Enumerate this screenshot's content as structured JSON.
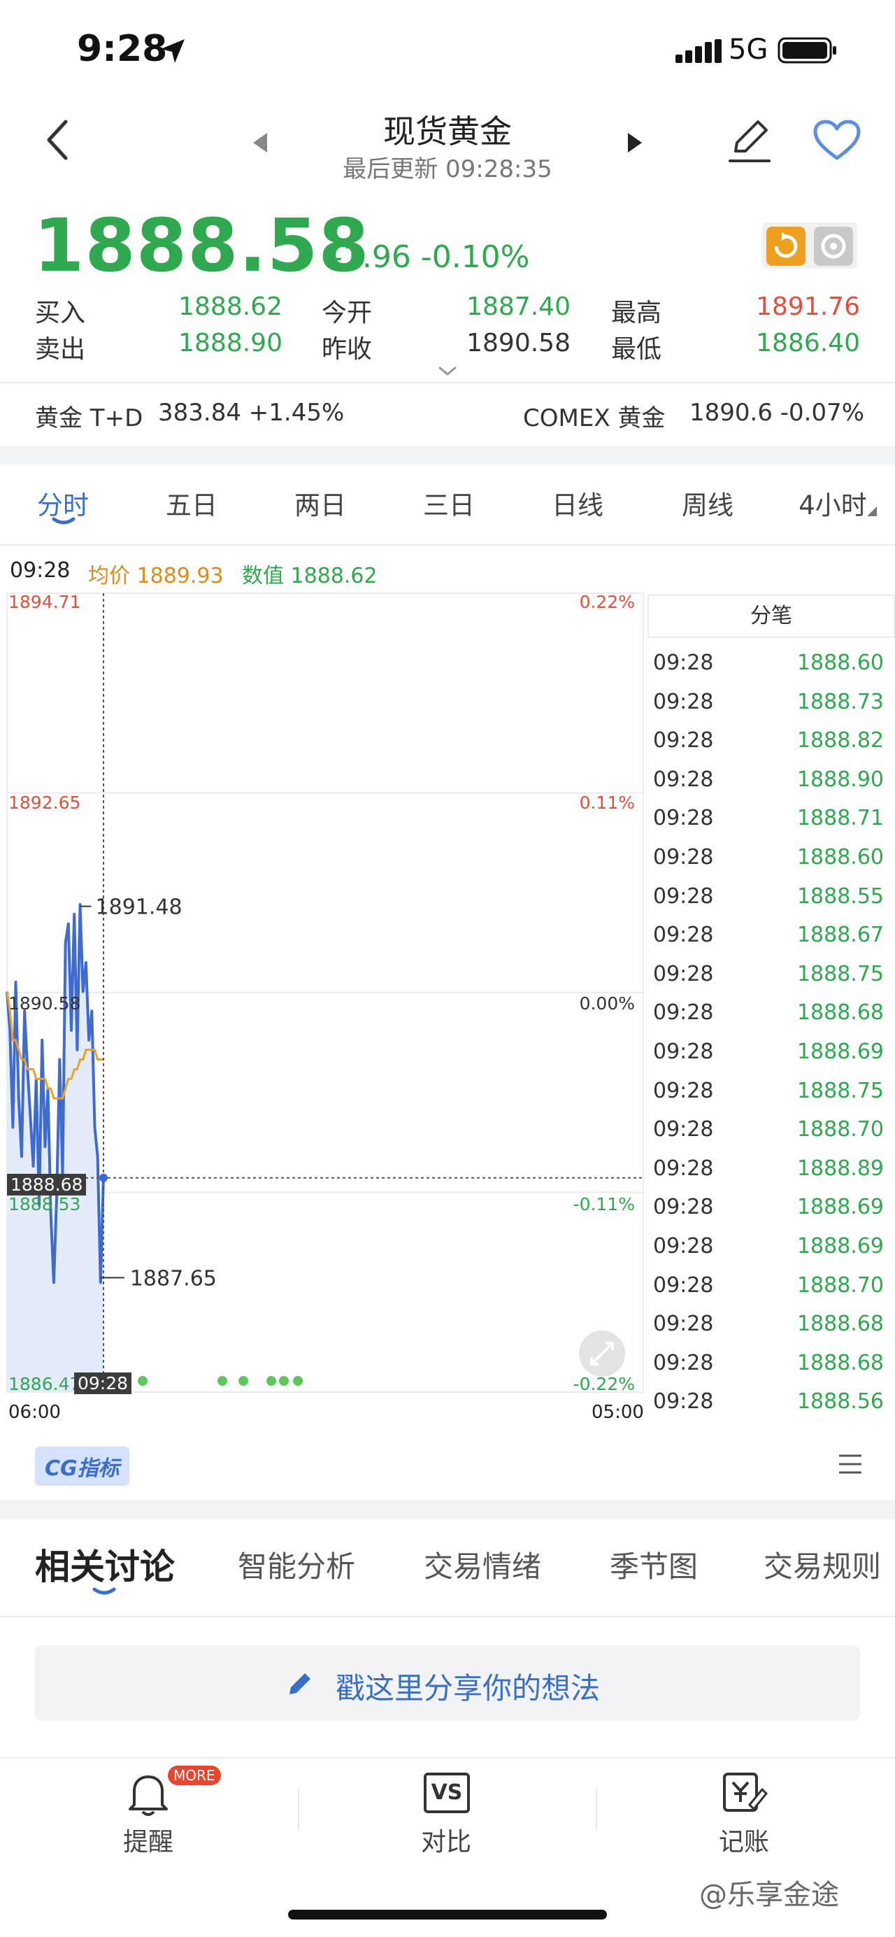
{
  "status": {
    "time": "9:28",
    "network": "5G"
  },
  "header": {
    "title": "现货黄金",
    "subtitle": "最后更新 09:28:35"
  },
  "quote": {
    "price": "1888.58",
    "change": "-1.96 -0.10%",
    "rows": [
      {
        "l1": "买入",
        "v1": "1888.62",
        "l2": "今开",
        "v2": "1887.40",
        "l3": "最高",
        "v3": "1891.76"
      },
      {
        "l1": "卖出",
        "v1": "1888.90",
        "l2": "昨收",
        "v2": "1890.58",
        "l3": "最低",
        "v3": "1886.40"
      }
    ]
  },
  "related": [
    {
      "name": "黄金 T+D",
      "value": "383.84 +1.45%"
    },
    {
      "name": "COMEX 黄金",
      "value": "1890.6 -0.07%"
    }
  ],
  "tabs": [
    "分时",
    "五日",
    "两日",
    "三日",
    "日线",
    "周线",
    "4小时"
  ],
  "info_line": {
    "time": "09:28",
    "avg": "均价 1889.93",
    "val": "数值 1888.62"
  },
  "colors": {
    "up": "#e0503b",
    "down": "#2fa84f",
    "accent": "#3a6fc8",
    "avg": "#f0a020"
  },
  "chart_data": {
    "type": "line",
    "y_left_ticks": [
      "1894.71",
      "1892.65",
      "1890.58",
      "1888.53",
      "1886.47"
    ],
    "y_right_ticks": [
      "0.22%",
      "0.11%",
      "0.00%",
      "-0.11%",
      "-0.22%"
    ],
    "x_start": "06:00",
    "x_end": "05:00",
    "ylim": [
      1886.47,
      1894.71
    ],
    "high_label": "1891.48",
    "low_label": "1887.65",
    "cursor_price": "1888.68",
    "cursor_time": "09:28",
    "series": [
      {
        "values": [
          1890.6,
          1890.2,
          1889.2,
          1890.7,
          1889.5,
          1888.9,
          1890.4,
          1889.8,
          1889.3,
          1888.8,
          1889.7,
          1888.4,
          1890.1,
          1889.0,
          1889.6,
          1888.3,
          1887.6,
          1888.5,
          1889.9,
          1888.7,
          1891.1,
          1891.3,
          1890.2,
          1891.4,
          1890.0,
          1891.5,
          1890.6,
          1890.9,
          1890.1,
          1890.4,
          1889.2,
          1888.9,
          1887.6,
          1888.7
        ]
      },
      {
        "values": [
          1890.6,
          1890.4,
          1890.1,
          1890.1,
          1890.0,
          1889.9,
          1889.9,
          1889.8,
          1889.8,
          1889.8,
          1889.7,
          1889.7,
          1889.7,
          1889.7,
          1889.6,
          1889.6,
          1889.5,
          1889.5,
          1889.5,
          1889.5,
          1889.6,
          1889.7,
          1889.7,
          1889.8,
          1889.8,
          1889.9,
          1889.9,
          1890.0,
          1890.0,
          1890.0,
          1890.0,
          1889.9,
          1889.9,
          1889.9
        ]
      }
    ]
  },
  "ticks_header": "分笔",
  "ticks": [
    [
      "09:28",
      "1888.60"
    ],
    [
      "09:28",
      "1888.73"
    ],
    [
      "09:28",
      "1888.82"
    ],
    [
      "09:28",
      "1888.90"
    ],
    [
      "09:28",
      "1888.71"
    ],
    [
      "09:28",
      "1888.60"
    ],
    [
      "09:28",
      "1888.55"
    ],
    [
      "09:28",
      "1888.67"
    ],
    [
      "09:28",
      "1888.75"
    ],
    [
      "09:28",
      "1888.68"
    ],
    [
      "09:28",
      "1888.69"
    ],
    [
      "09:28",
      "1888.75"
    ],
    [
      "09:28",
      "1888.70"
    ],
    [
      "09:28",
      "1888.89"
    ],
    [
      "09:28",
      "1888.69"
    ],
    [
      "09:28",
      "1888.69"
    ],
    [
      "09:28",
      "1888.70"
    ],
    [
      "09:28",
      "1888.68"
    ],
    [
      "09:28",
      "1888.68"
    ],
    [
      "09:28",
      "1888.56"
    ]
  ],
  "cg_badge": "CG指标",
  "bottom_tabs": [
    "相关讨论",
    "智能分析",
    "交易情绪",
    "季节图",
    "交易规则"
  ],
  "share_placeholder": "戳这里分享你的想法",
  "nav": {
    "remind": "提醒",
    "more_badge": "MORE",
    "compare": "对比",
    "vs": "VS",
    "ledger": "记账"
  },
  "watermark": "@乐享金途"
}
